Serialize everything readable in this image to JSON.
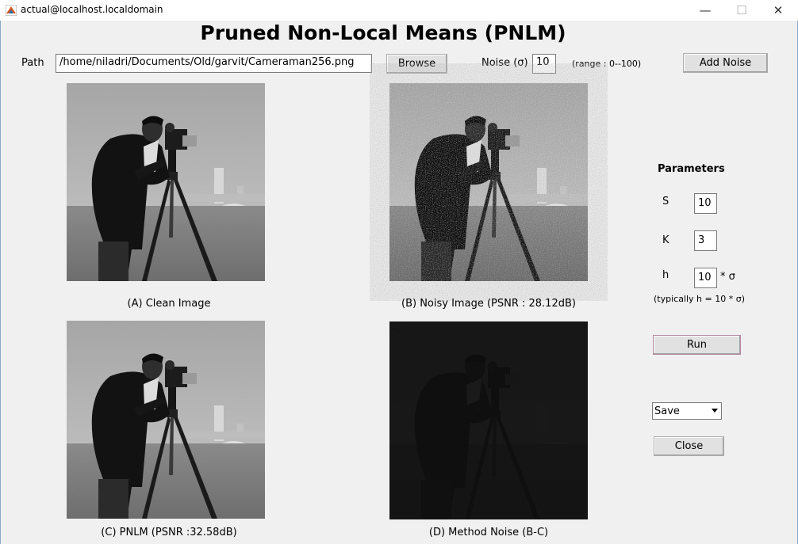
{
  "window": {
    "title": "actual@localhost.localdomain",
    "minimize": "—",
    "maximize": "☐",
    "close": "✕"
  },
  "header": {
    "title": "Pruned Non-Local Means (PNLM)"
  },
  "path": {
    "label": "Path",
    "value": "/home/niladri/Documents/Old/garvit/Cameraman256.png",
    "browse_label": "Browse"
  },
  "noise": {
    "label": "Noise (σ)",
    "value": "10",
    "range_text": "(range : 0--100)",
    "add_label": "Add Noise"
  },
  "images": {
    "clean_caption": "(A) Clean Image",
    "noisy_caption": "(B) Noisy Image (PSNR : 28.12dB)",
    "pnlm_caption": "(C) PNLM (PSNR :32.58dB)",
    "method_caption": "(D) Method Noise (B-C)"
  },
  "parameters": {
    "heading": "Parameters",
    "s_label": "S",
    "s_value": "10",
    "k_label": "K",
    "k_value": "3",
    "h_label": "h",
    "h_value": "10",
    "h_suffix": "* σ",
    "hint": "(typically h = 10 * σ)"
  },
  "actions": {
    "run_label": "Run",
    "save_selected": "Save",
    "close_label": "Close"
  },
  "colors": {
    "background": "#f0f0f0",
    "titlebar": "#ffffff",
    "button_face": "#e1e1e1",
    "method_noise": "#0f0f0f"
  }
}
